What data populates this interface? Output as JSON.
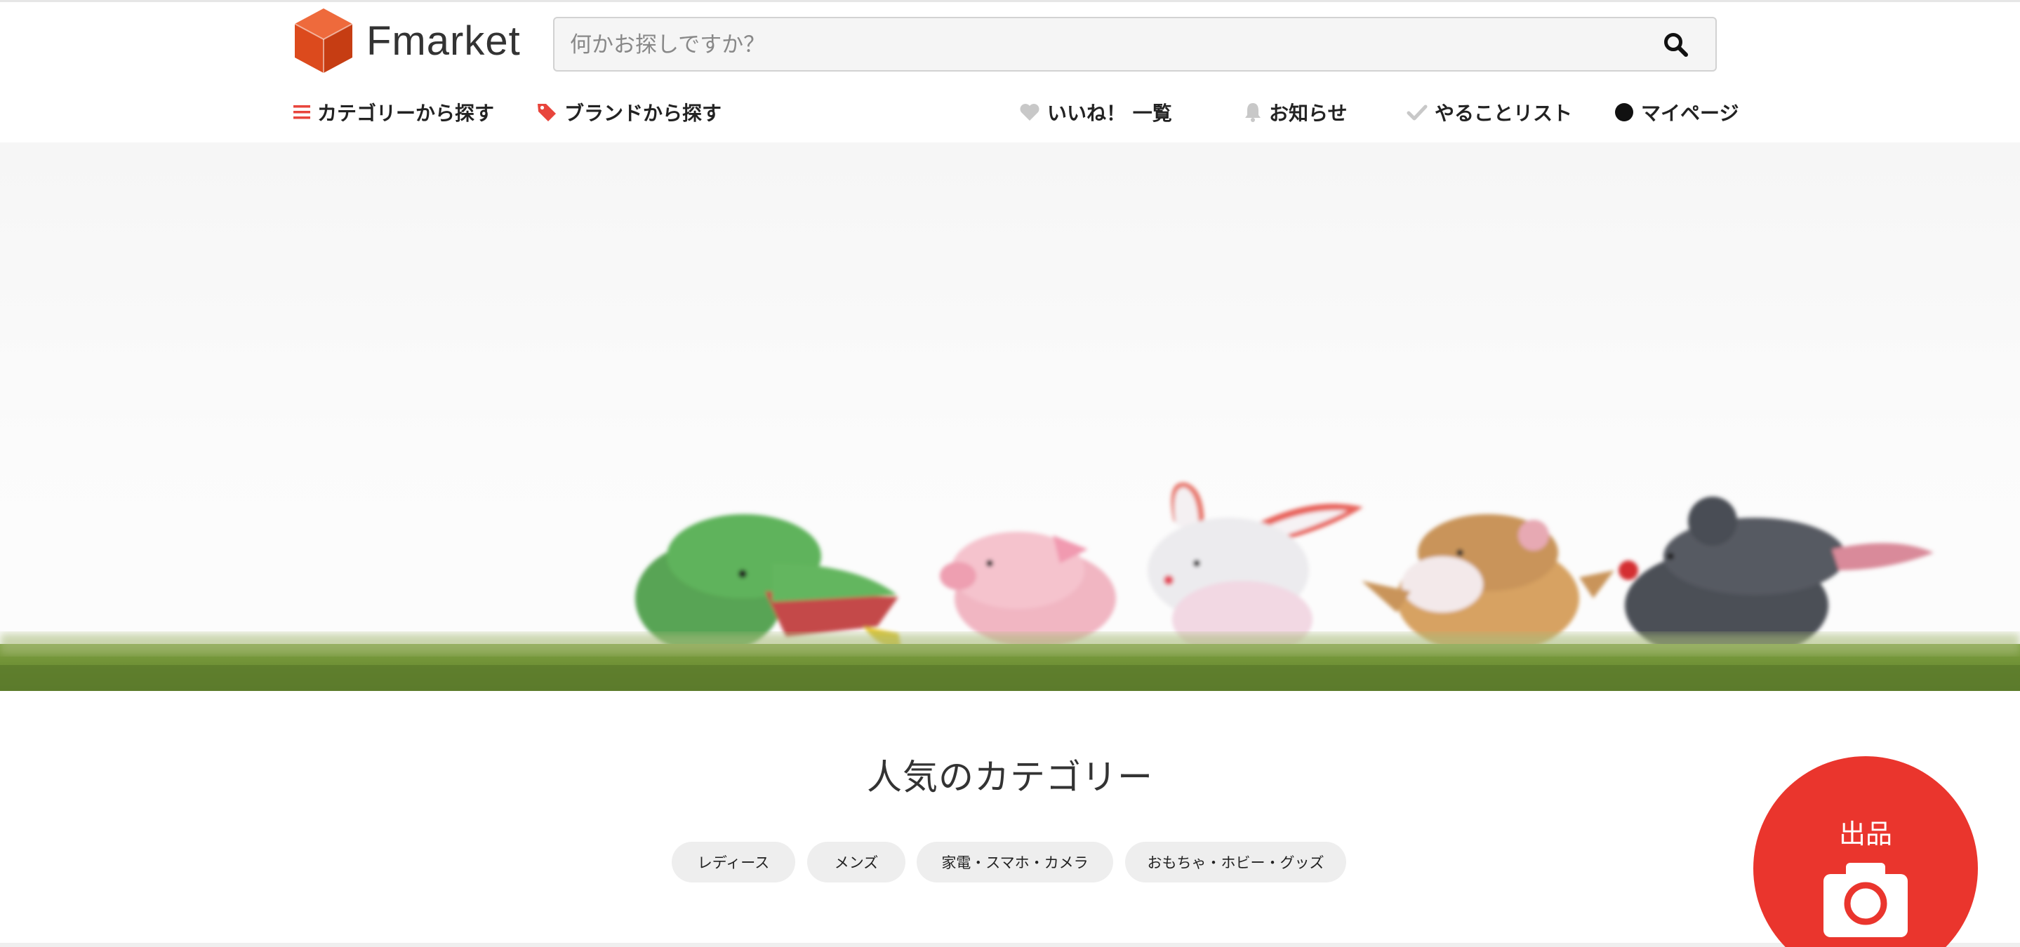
{
  "header": {
    "logo_text": "Fmarket",
    "brand_color": "#e8502a"
  },
  "search": {
    "placeholder": "何かお探しですか？",
    "value": "",
    "icon": "search-icon"
  },
  "nav": {
    "left": [
      {
        "label": "カテゴリーから探す",
        "icon": "menu-icon",
        "icon_color": "#e8453c"
      },
      {
        "label": "ブランドから探す",
        "icon": "tag-icon",
        "icon_color": "#e8453c"
      }
    ],
    "right": [
      {
        "label": "いいね！ 一覧",
        "icon": "heart-icon",
        "icon_color": "#c8c8c8"
      },
      {
        "label": "お知らせ",
        "icon": "bell-icon",
        "icon_color": "#c8c8c8"
      },
      {
        "label": "やることリスト",
        "icon": "check-icon",
        "icon_color": "#c8c8c8"
      },
      {
        "label": "マイページ",
        "icon": "user-dot-icon",
        "icon_color": "#111111"
      }
    ]
  },
  "hero": {
    "image": "finger-puppets-on-grass",
    "figures": [
      "green-dinosaur",
      "pink-pig",
      "white-rabbit",
      "brown-cow",
      "gray-mouse"
    ]
  },
  "categories": {
    "title": "人気のカテゴリー",
    "chips": [
      "レディース",
      "メンズ",
      "家電・スマホ・カメラ",
      "おもちゃ・ホビー・グッズ"
    ]
  },
  "sell": {
    "label": "出品",
    "icon": "camera-icon",
    "color": "#ea352d"
  }
}
